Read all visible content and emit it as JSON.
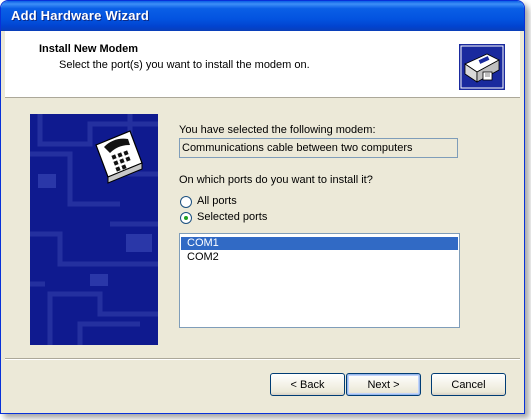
{
  "window": {
    "title": "Add Hardware Wizard"
  },
  "header": {
    "title": "Install New Modem",
    "subtitle": "Select the port(s) you want to install the modem on."
  },
  "icons": {
    "header": "hardware-wizard-icon",
    "side": "telephone-modem-icon"
  },
  "modem": {
    "label": "You have selected the following modem:",
    "value": "Communications cable between two computers"
  },
  "ports": {
    "question": "On which ports do you want to install it?",
    "options": [
      {
        "label": "All ports",
        "checked": false
      },
      {
        "label": "Selected ports",
        "checked": true
      }
    ],
    "list": [
      {
        "label": "COM1",
        "selected": true
      },
      {
        "label": "COM2",
        "selected": false
      }
    ]
  },
  "buttons": {
    "back": "< Back",
    "next": "Next >",
    "cancel": "Cancel"
  },
  "colors": {
    "title_bar": "#0a5fe6",
    "side_panel": "#0f1a8f",
    "selection": "#316ac5"
  }
}
